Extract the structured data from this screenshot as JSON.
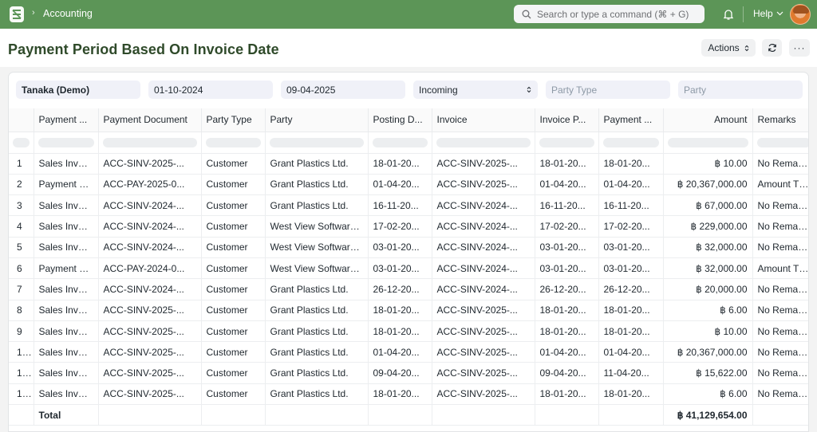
{
  "navbar": {
    "breadcrumb": "Accounting",
    "search_placeholder": "Search or type a command (⌘ + G)",
    "help_label": "Help"
  },
  "page": {
    "title": "Payment Period Based On Invoice Date",
    "actions_label": "Actions",
    "more_label": "···"
  },
  "filters": {
    "company": "Tanaka (Demo)",
    "from_date": "01-10-2024",
    "to_date": "09-04-2025",
    "payment_type": "Incoming",
    "party_type_placeholder": "Party Type",
    "party_placeholder": "Party"
  },
  "table": {
    "columns": [
      "Payment ...",
      "Payment Document",
      "Party Type",
      "Party",
      "Posting D...",
      "Invoice",
      "Invoice P...",
      "Payment ...",
      "Amount",
      "Remarks"
    ],
    "rows": [
      {
        "idx": "1",
        "cells": [
          "Sales Invoi...",
          "ACC-SINV-2025-...",
          "Customer",
          "Grant Plastics Ltd.",
          "18-01-20...",
          "ACC-SINV-2025-...",
          "18-01-20...",
          "18-01-20...",
          "฿ 10.00",
          "No Remarks"
        ]
      },
      {
        "idx": "2",
        "cells": [
          "Payment E...",
          "ACC-PAY-2025-0...",
          "Customer",
          "Grant Plastics Ltd.",
          "01-04-20...",
          "ACC-SINV-2025-...",
          "01-04-20...",
          "01-04-20...",
          "฿ 20,367,000.00",
          "Amount THB"
        ]
      },
      {
        "idx": "3",
        "cells": [
          "Sales Invoi...",
          "ACC-SINV-2024-...",
          "Customer",
          "Grant Plastics Ltd.",
          "16-11-20...",
          "ACC-SINV-2024-...",
          "16-11-20...",
          "16-11-20...",
          "฿ 67,000.00",
          "No Remarks"
        ]
      },
      {
        "idx": "4",
        "cells": [
          "Sales Invoi...",
          "ACC-SINV-2024-...",
          "Customer",
          "West View Software...",
          "17-02-20...",
          "ACC-SINV-2024-...",
          "17-02-20...",
          "17-02-20...",
          "฿ 229,000.00",
          "No Remarks"
        ]
      },
      {
        "idx": "5",
        "cells": [
          "Sales Invoi...",
          "ACC-SINV-2024-...",
          "Customer",
          "West View Software...",
          "03-01-20...",
          "ACC-SINV-2024-...",
          "03-01-20...",
          "03-01-20...",
          "฿ 32,000.00",
          "No Remarks"
        ]
      },
      {
        "idx": "6",
        "cells": [
          "Payment E...",
          "ACC-PAY-2024-0...",
          "Customer",
          "West View Software...",
          "03-01-20...",
          "ACC-SINV-2024-...",
          "03-01-20...",
          "03-01-20...",
          "฿ 32,000.00",
          "Amount THB"
        ]
      },
      {
        "idx": "7",
        "cells": [
          "Sales Invoi...",
          "ACC-SINV-2024-...",
          "Customer",
          "Grant Plastics Ltd.",
          "26-12-20...",
          "ACC-SINV-2024-...",
          "26-12-20...",
          "26-12-20...",
          "฿ 20,000.00",
          "No Remarks"
        ]
      },
      {
        "idx": "8",
        "cells": [
          "Sales Invoi...",
          "ACC-SINV-2025-...",
          "Customer",
          "Grant Plastics Ltd.",
          "18-01-20...",
          "ACC-SINV-2025-...",
          "18-01-20...",
          "18-01-20...",
          "฿ 6.00",
          "No Remarks"
        ]
      },
      {
        "idx": "9",
        "cells": [
          "Sales Invoi...",
          "ACC-SINV-2025-...",
          "Customer",
          "Grant Plastics Ltd.",
          "18-01-20...",
          "ACC-SINV-2025-...",
          "18-01-20...",
          "18-01-20...",
          "฿ 10.00",
          "No Remarks"
        ]
      },
      {
        "idx": "1...",
        "cells": [
          "Sales Invoi...",
          "ACC-SINV-2025-...",
          "Customer",
          "Grant Plastics Ltd.",
          "01-04-20...",
          "ACC-SINV-2025-...",
          "01-04-20...",
          "01-04-20...",
          "฿ 20,367,000.00",
          "No Remarks"
        ]
      },
      {
        "idx": "1...",
        "cells": [
          "Sales Invoi...",
          "ACC-SINV-2025-...",
          "Customer",
          "Grant Plastics Ltd.",
          "09-04-20...",
          "ACC-SINV-2025-...",
          "09-04-20...",
          "11-04-20...",
          "฿ 15,622.00",
          "No Remarks"
        ]
      },
      {
        "idx": "1...",
        "cells": [
          "Sales Invoi...",
          "ACC-SINV-2025-...",
          "Customer",
          "Grant Plastics Ltd.",
          "18-01-20...",
          "ACC-SINV-2025-...",
          "18-01-20...",
          "18-01-20...",
          "฿ 6.00",
          "No Remarks"
        ]
      }
    ],
    "total_label": "Total",
    "total_amount": "฿ 41,129,654.00"
  },
  "colors": {
    "navbar": "#5c9557",
    "title": "#2f4a2a",
    "filter_bg": "#f0f1f8"
  }
}
